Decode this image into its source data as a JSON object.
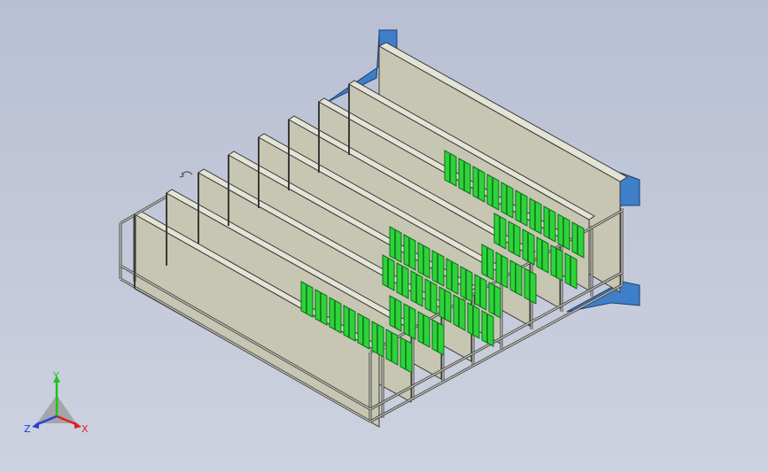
{
  "viewport": {
    "background_top": "#b8bfd3",
    "background_bottom": "#cdd2df"
  },
  "model": {
    "colors": {
      "panel_face": "#c6c6b2",
      "panel_top": "#e4e4d6",
      "panel_edge": "#3a3a3a",
      "frame": "#b9b9ad",
      "bracket": "#3f7fc9",
      "bracket_dark": "#2a5b98",
      "module_green": "#2ed33a",
      "module_dark": "#0b6f17"
    }
  },
  "triad": {
    "x_label": "X",
    "y_label": "Y",
    "z_label": "Z",
    "colors": {
      "x": "#e02020",
      "y": "#20c020",
      "z": "#2040e0"
    }
  }
}
